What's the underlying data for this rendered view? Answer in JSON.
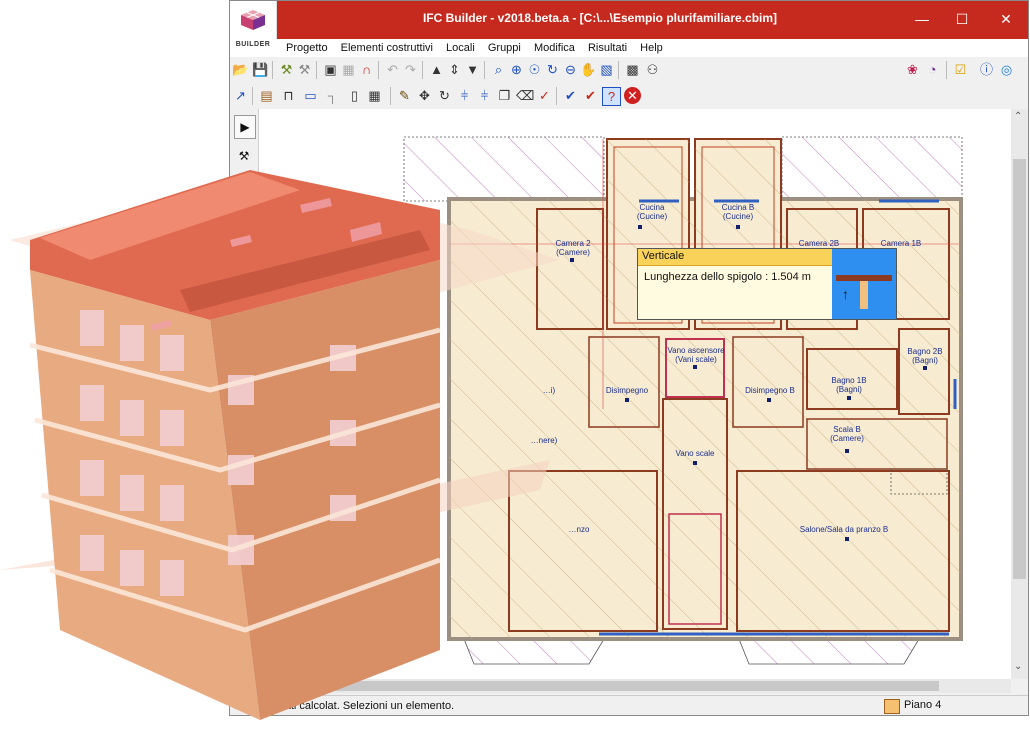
{
  "window": {
    "title": "IFC Builder - v2018.beta.a - [C:\\...\\Esempio plurifamiliare.cbim]",
    "logo_text": "BUILDER",
    "controls": {
      "minimize": "—",
      "maximize": "☐",
      "close": "✕"
    }
  },
  "menu": [
    "Progetto",
    "Elementi costruttivi",
    "Locali",
    "Gruppi",
    "Modifica",
    "Risultati",
    "Help"
  ],
  "rooms": [
    {
      "label": "Cucina\n(Cucine)"
    },
    {
      "label": "Cucina B\n(Cucine)"
    },
    {
      "label": "Camera 2\n(Camere)"
    },
    {
      "label": "Camera 2B"
    },
    {
      "label": "Camera 1B"
    },
    {
      "label": "Vano ascensore\n(Vani scale)"
    },
    {
      "label": "Disimpegno"
    },
    {
      "label": "Disimpegno B"
    },
    {
      "label": "Bagno 1B\n(Bagni)"
    },
    {
      "label": "Bagno 2B\n(Bagni)"
    },
    {
      "label": "Vano scale"
    },
    {
      "label": "Scala B\n(Camere)"
    },
    {
      "label": "Salone/Sala da pranzo B"
    },
    {
      "label": "…nzo"
    },
    {
      "label": "…i)"
    },
    {
      "label": "…nere)"
    }
  ],
  "tooltip": {
    "header": "Verticale",
    "text": "Lunghezza dello spigolo : 1.504 m"
  },
  "status": {
    "message": "Risulta…                    tati calcolat.  Selezioni un elemento.",
    "floor": "Piano 4"
  },
  "colors": {
    "titlebar": "#c62a1e",
    "accent": "#2f8ff0",
    "plan_fill": "#f7ecd2",
    "wall": "#8c3a20"
  }
}
